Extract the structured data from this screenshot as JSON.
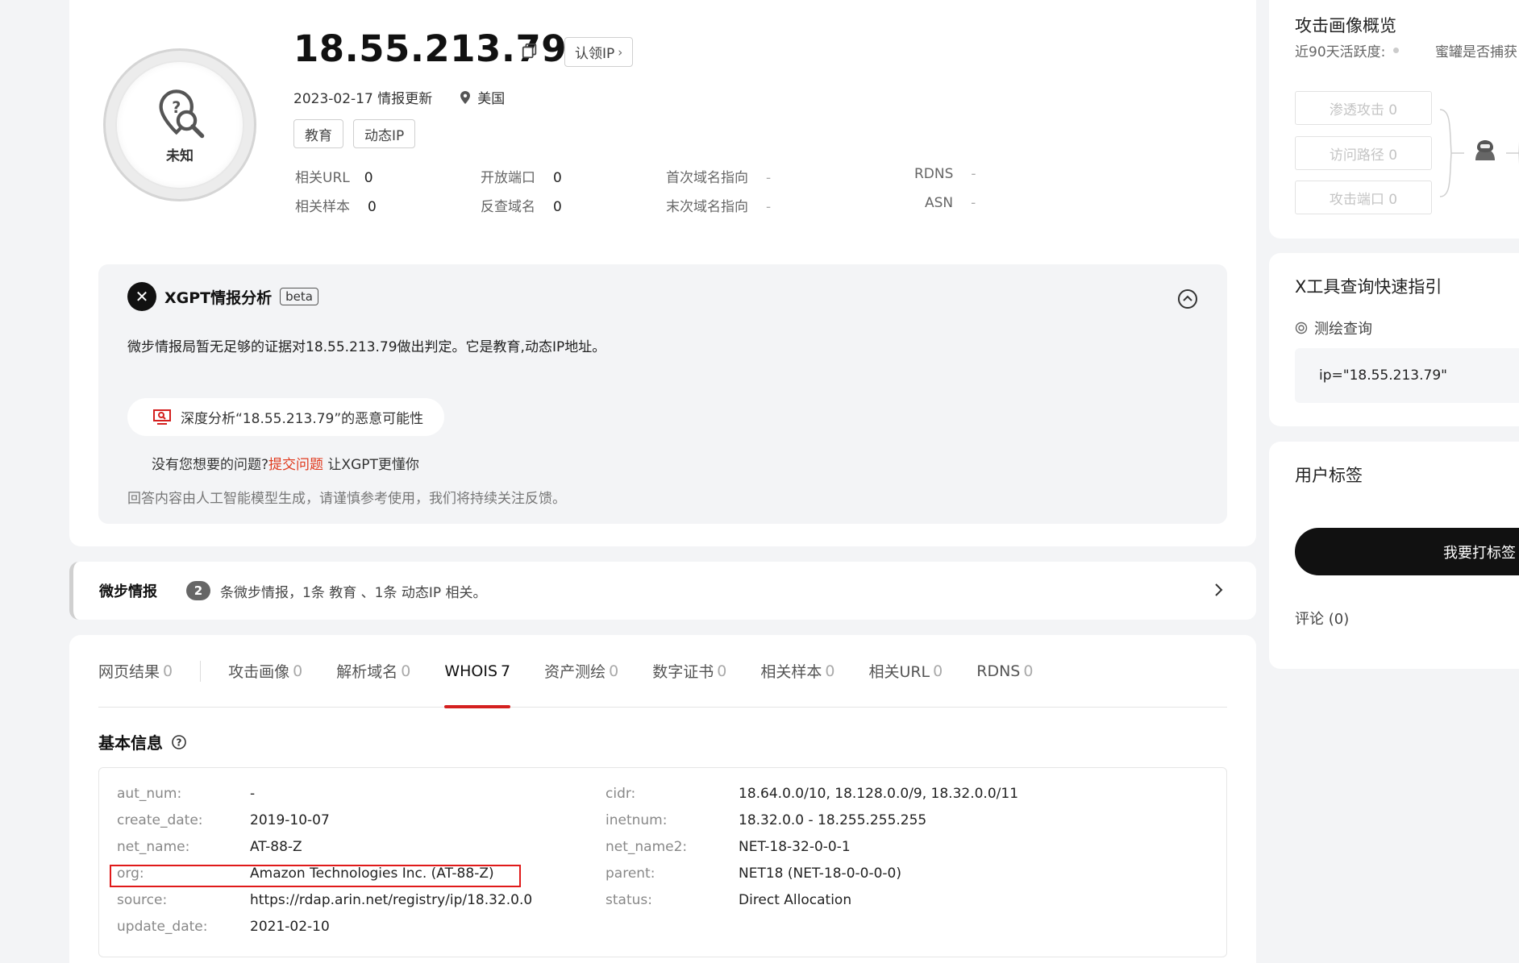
{
  "header": {
    "ip": "18.55.213.79",
    "claim_label": "认领IP",
    "update_date": "2023-02-17 情报更新",
    "location": "美国",
    "badge_label": "未知",
    "tags": [
      "教育",
      "动态IP"
    ],
    "stats": {
      "related_url": {
        "label": "相关URL",
        "value": "0"
      },
      "open_ports": {
        "label": "开放端口",
        "value": "0"
      },
      "first_domain": {
        "label": "首次域名指向",
        "value": "-"
      },
      "rdns": {
        "label": "RDNS",
        "value": "-"
      },
      "related_samples": {
        "label": "相关样本",
        "value": "0"
      },
      "reverse_domain": {
        "label": "反查域名",
        "value": "0"
      },
      "last_domain": {
        "label": "末次域名指向",
        "value": "-"
      },
      "asn": {
        "label": "ASN",
        "value": "-"
      }
    }
  },
  "xgpt": {
    "title": "XGPT情报分析",
    "beta": "beta",
    "analysis": "微步情报局暂无足够的证据对18.55.213.79做出判定。它是教育,动态IP地址。",
    "deep_analysis": "深度分析“18.55.213.79”的恶意可能性",
    "feedback_prefix": "没有您想要的问题?",
    "feedback_link": "提交问题",
    "feedback_suffix": " 让XGPT更懂你",
    "disclaimer": "回答内容由人工智能模型生成，请谨慎参考使用，我们将持续关注反馈。"
  },
  "intel": {
    "title": "微步情报",
    "count": "2",
    "description": "条微步情报，1条 教育 、1条 动态IP 相关。"
  },
  "tabs": [
    {
      "label": "网页结果",
      "count": "0"
    },
    {
      "label": "攻击画像",
      "count": "0"
    },
    {
      "label": "解析域名",
      "count": "0"
    },
    {
      "label": "WHOIS",
      "count": "7"
    },
    {
      "label": "资产测绘",
      "count": "0"
    },
    {
      "label": "数字证书",
      "count": "0"
    },
    {
      "label": "相关样本",
      "count": "0"
    },
    {
      "label": "相关URL",
      "count": "0"
    },
    {
      "label": "RDNS",
      "count": "0"
    }
  ],
  "whois": {
    "section_title": "基本信息",
    "left": [
      {
        "key": "aut_num:",
        "value": "-"
      },
      {
        "key": "create_date:",
        "value": "2019-10-07"
      },
      {
        "key": "net_name:",
        "value": "AT-88-Z"
      },
      {
        "key": "org:",
        "value": "Amazon Technologies Inc. (AT-88-Z)"
      },
      {
        "key": "source:",
        "value": "https://rdap.arin.net/registry/ip/18.32.0.0"
      },
      {
        "key": "update_date:",
        "value": "2021-02-10"
      }
    ],
    "right": [
      {
        "key": "cidr:",
        "value": "18.64.0.0/10, 18.128.0.0/9, 18.32.0.0/11"
      },
      {
        "key": "inetnum:",
        "value": "18.32.0.0 - 18.255.255.255"
      },
      {
        "key": "net_name2:",
        "value": "NET-18-32-0-0-1"
      },
      {
        "key": "parent:",
        "value": "NET18 (NET-18-0-0-0-0)"
      },
      {
        "key": "status:",
        "value": "Direct Allocation"
      }
    ]
  },
  "sidebar": {
    "attack_title": "攻击画像概览",
    "activity_label": "近90天活跃度:",
    "honeypot_label": "蜜罐是否捕获",
    "boxes": [
      "渗透攻击 0",
      "访问路径 0",
      "攻击端口 0"
    ],
    "xtool_title": "X工具查询快速指引",
    "mapping_label": "测绘查询",
    "query": "ip=\"18.55.213.79\"",
    "user_tags_title": "用户标签",
    "tag_button": "我要打标签",
    "comments": "评论 (0)"
  },
  "colors": {
    "accent": "#d4201f",
    "link": "#e03a1e",
    "highlight_box": "#e01a1a"
  }
}
